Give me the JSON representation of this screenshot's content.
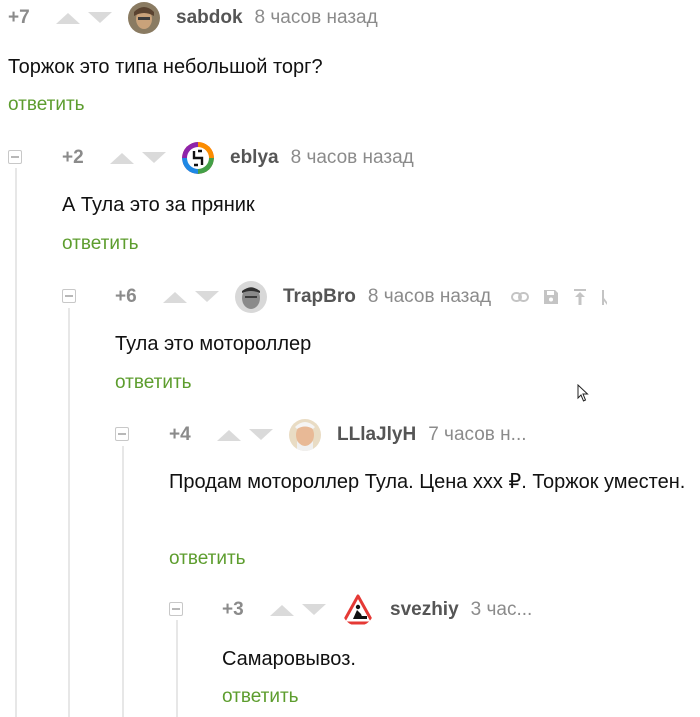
{
  "comments": [
    {
      "rating": "+7",
      "user": "sabdok",
      "time": "8 часов назад",
      "text": "Торжок это типа небольшой торг?",
      "reply": "ответить"
    },
    {
      "rating": "+2",
      "user": "eblya",
      "time": "8 часов назад",
      "text": "А Тула это за пряник",
      "reply": "ответить"
    },
    {
      "rating": "+6",
      "user": "TrapBro",
      "time": "8 часов назад",
      "text": "Тула это мотороллер",
      "reply": "ответить"
    },
    {
      "rating": "+4",
      "user": "LLlaJlyH",
      "time": "7 часов н...",
      "text": "Продам мотороллер Тула. Цена xxx ₽. Торжок уместен.",
      "reply": "ответить"
    },
    {
      "rating": "+3",
      "user": "svezhiy",
      "time": "3 час...",
      "text": "Самаровывоз.",
      "reply": "ответить"
    }
  ],
  "colors": {
    "reply": "#5d9d2e",
    "meta": "#8b8b8b",
    "line": "#e7e7e7"
  }
}
